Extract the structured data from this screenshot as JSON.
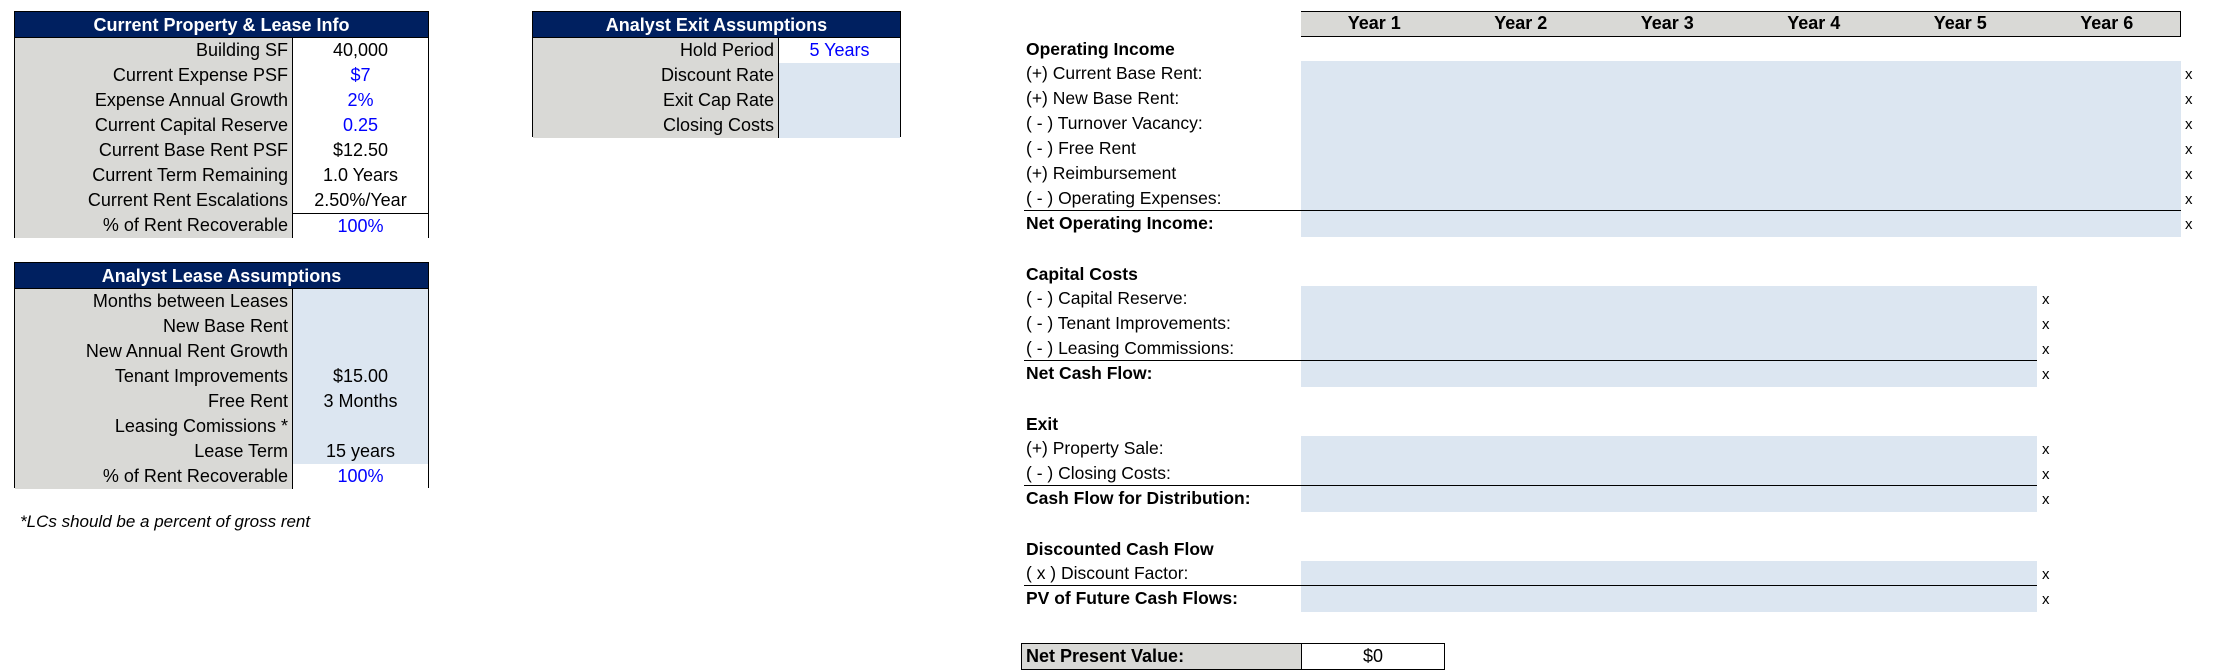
{
  "colors": {
    "header_bg": "#002060",
    "label_bg": "#d9d9d6",
    "input_bg": "#dce6f1",
    "input_text": "#0000ff"
  },
  "current_property": {
    "title": "Current Property & Lease Info",
    "rows": [
      {
        "label": "Building SF",
        "value": "40,000",
        "input": false
      },
      {
        "label": "Current Expense PSF",
        "value": "$7",
        "input": true
      },
      {
        "label": "Expense Annual Growth",
        "value": "2%",
        "input": true
      },
      {
        "label": "Current Capital Reserve",
        "value": "0.25",
        "input": true
      },
      {
        "label": "Current Base Rent PSF",
        "value": "$12.50",
        "input": false
      },
      {
        "label": "Current Term Remaining",
        "value": "1.0 Years",
        "input": false
      },
      {
        "label": "Current Rent Escalations",
        "value": "2.50%/Year",
        "input": false
      },
      {
        "label": "% of Rent Recoverable",
        "value": "100%",
        "input": true
      }
    ]
  },
  "lease_assumptions": {
    "title": "Analyst Lease Assumptions",
    "rows": [
      {
        "label": "Months between Leases",
        "value": ""
      },
      {
        "label": "New Base Rent",
        "value": ""
      },
      {
        "label": "New Annual Rent Growth",
        "value": ""
      },
      {
        "label": "Tenant Improvements",
        "value": "$15.00"
      },
      {
        "label": "Free Rent",
        "value": "3 Months"
      },
      {
        "label": "Leasing Comissions *",
        "value": ""
      },
      {
        "label": "Lease Term",
        "value": "15 years"
      },
      {
        "label": "% of Rent Recoverable",
        "value": "100%"
      }
    ],
    "note": "*LCs should be a percent of gross rent"
  },
  "exit_assumptions": {
    "title": "Analyst Exit Assumptions",
    "rows": [
      {
        "label": "Hold Period",
        "value": "5 Years"
      },
      {
        "label": "Discount Rate",
        "value": ""
      },
      {
        "label": "Exit Cap Rate",
        "value": ""
      },
      {
        "label": "Closing Costs",
        "value": ""
      }
    ]
  },
  "projection": {
    "years": [
      "Year 1",
      "Year 2",
      "Year 3",
      "Year 4",
      "Year 5",
      "Year 6"
    ],
    "marker": "x",
    "operating_income": {
      "title": "Operating Income",
      "rows": [
        "(+) Current Base Rent:",
        "(+) New Base Rent:",
        "( - ) Turnover Vacancy:",
        "( - ) Free Rent",
        "(+) Reimbursement",
        "( - ) Operating Expenses:"
      ],
      "total": "Net Operating Income:"
    },
    "capital_costs": {
      "title": "Capital Costs",
      "rows": [
        "( - ) Capital Reserve:",
        "( - ) Tenant Improvements:",
        "( - ) Leasing Commissions:"
      ],
      "total": "Net Cash Flow:"
    },
    "exit": {
      "title": "Exit",
      "rows": [
        "(+) Property Sale:",
        "( - ) Closing Costs:"
      ],
      "total": "Cash Flow for Distribution:"
    },
    "dcf": {
      "title": "Discounted Cash Flow",
      "rows": [
        "( x ) Discount Factor:"
      ],
      "total": "PV of Future Cash Flows:"
    },
    "npv": {
      "label": "Net Present Value:",
      "value": "$0"
    }
  }
}
